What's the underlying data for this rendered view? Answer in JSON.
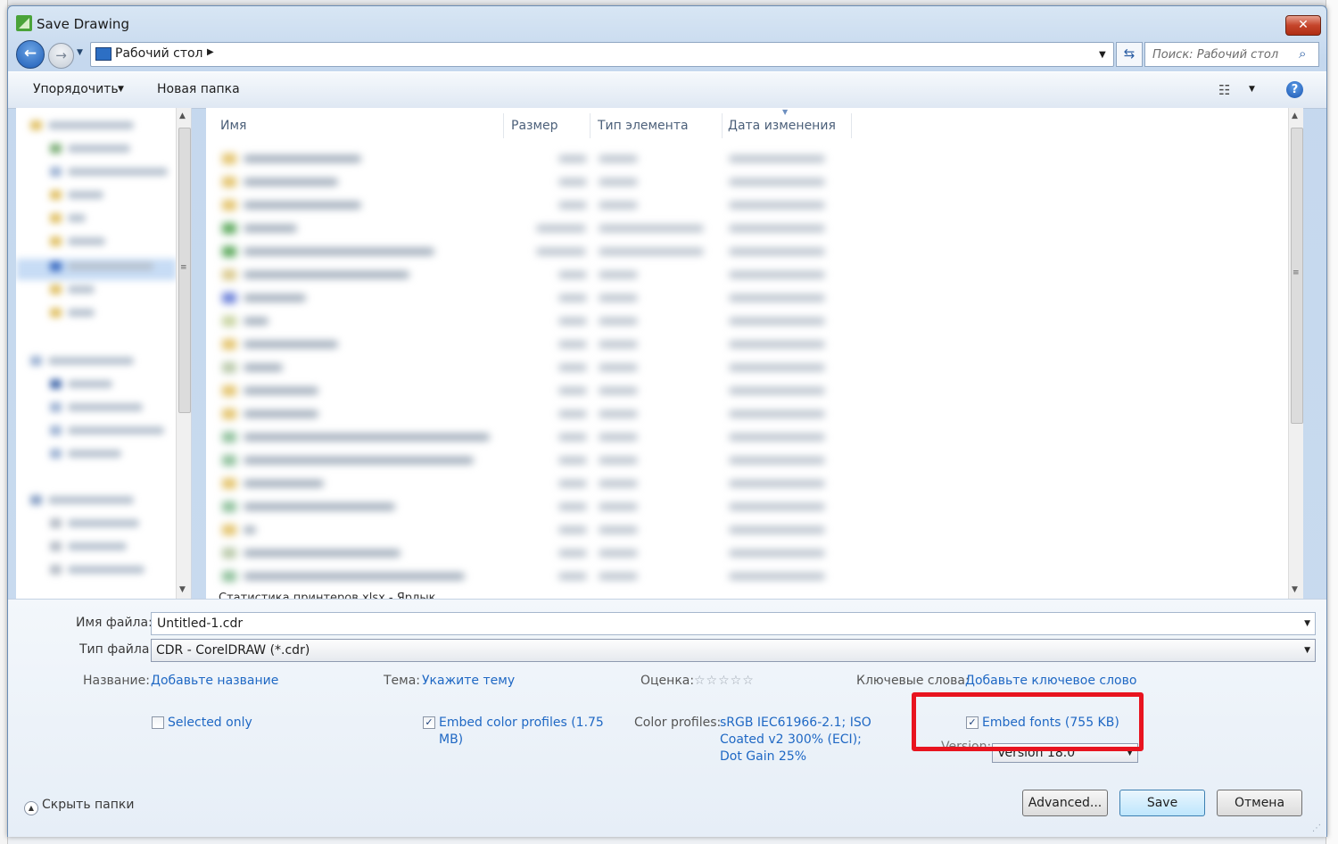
{
  "window": {
    "title": "Save Drawing",
    "close_label": "✕"
  },
  "nav": {
    "address": "Рабочий стол",
    "search_placeholder": "Поиск: Рабочий стол"
  },
  "toolbar": {
    "organize_label": "Упорядочить",
    "new_folder_label": "Новая папка"
  },
  "file_list": {
    "columns": [
      "Имя",
      "Размер",
      "Тип элемента",
      "Дата изменения"
    ],
    "partial_last_row": "Статистика принтеров.xlsx - Ярлык"
  },
  "form": {
    "filename_label": "Имя файла:",
    "filename_value": "Untitled-1.cdr",
    "filetype_label": "Тип файла:",
    "filetype_value": "CDR - CorelDRAW (*.cdr)",
    "title_label": "Название:",
    "title_link": "Добавьте название",
    "subject_label": "Тема:",
    "subject_link": "Укажите тему",
    "rating_label": "Оценка:",
    "rating_stars": "☆☆☆☆☆",
    "rating_value": 0,
    "keywords_label": "Ключевые слова:",
    "keywords_link": "Добавьте ключевое слово",
    "selected_only_label": "Selected only",
    "selected_only_checked": false,
    "embed_profiles_label_1": "Embed color profiles (1.75",
    "embed_profiles_label_2": "MB)",
    "embed_profiles_checked": true,
    "color_profiles_label": "Color profiles:",
    "color_profiles_line1": "sRGB IEC61966-2.1; ISO",
    "color_profiles_line2": "Coated v2 300% (ECI);",
    "color_profiles_line3": "Dot Gain 25%",
    "embed_fonts_label": "Embed fonts (755 KB)",
    "embed_fonts_checked": true,
    "version_label": "Version:",
    "version_value": "Version 18.0"
  },
  "footer": {
    "hide_folders_label": "Скрыть папки",
    "advanced_label": "Advanced...",
    "save_label": "Save",
    "cancel_label": "Отмена"
  },
  "colors": {
    "highlight": "#e8141f",
    "link": "#1f68c4"
  }
}
